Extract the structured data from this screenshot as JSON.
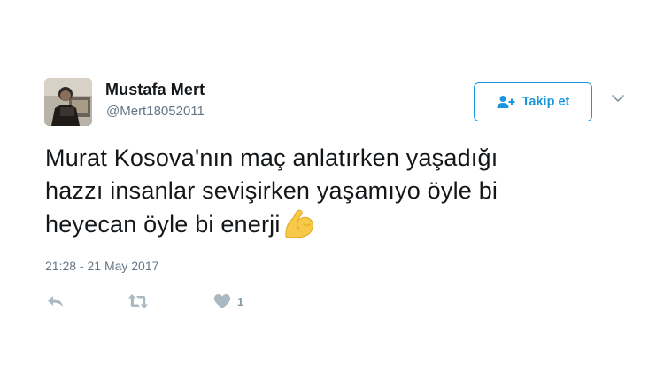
{
  "tweet": {
    "author": {
      "display_name": "Mustafa Mert",
      "handle": "@Mert18052011",
      "avatar_icon": "profile-photo"
    },
    "follow_button": {
      "label": "Takip et",
      "icon": "add-user-icon"
    },
    "menu_icon": "chevron-down-icon",
    "text_lines": [
      "Murat Kosova'nın maç anlatırken yaşadığı",
      "hazzı insanlar sevişirken yaşamıyo öyle bi",
      "heyecan öyle bi enerji"
    ],
    "emoji": "flexed-biceps",
    "timestamp": "21:28 - 21 May 2017",
    "actions": {
      "reply_icon": "reply-icon",
      "retweet_icon": "retweet-icon",
      "like_icon": "heart-icon",
      "like_count": "1"
    }
  },
  "colors": {
    "accent": "#1b95e0",
    "text": "#14171a",
    "secondary": "#657786",
    "action_gray": "#aab8c2"
  }
}
